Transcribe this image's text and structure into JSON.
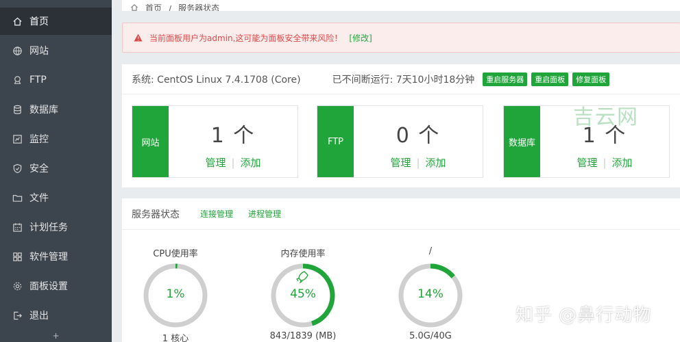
{
  "sidebar": {
    "items": [
      {
        "label": "首页",
        "icon": "home-icon",
        "active": true
      },
      {
        "label": "网站",
        "icon": "globe-icon"
      },
      {
        "label": "FTP",
        "icon": "ftp-icon"
      },
      {
        "label": "数据库",
        "icon": "database-icon"
      },
      {
        "label": "监控",
        "icon": "monitor-icon"
      },
      {
        "label": "安全",
        "icon": "shield-icon"
      },
      {
        "label": "文件",
        "icon": "folder-icon"
      },
      {
        "label": "计划任务",
        "icon": "calendar-icon"
      },
      {
        "label": "软件管理",
        "icon": "grid-icon"
      },
      {
        "label": "面板设置",
        "icon": "gear-icon"
      },
      {
        "label": "退出",
        "icon": "logout-icon"
      }
    ],
    "bottom_glyph": "+"
  },
  "breadcrumb": {
    "home": "首页",
    "sep": "/",
    "current": "服务器状态"
  },
  "alert": {
    "message": "当前面板用户为admin,这可能为面板安全带来风险！",
    "link": "[修改]"
  },
  "system": {
    "os": "系统: CentOS Linux 7.4.1708 (Core)",
    "uptime": "已不间断运行: 7天10小时18分钟",
    "buttons": [
      "重启服务器",
      "重启面板",
      "修复面板"
    ]
  },
  "cards": [
    {
      "tag": "网站",
      "count": "1 个",
      "manage": "管理",
      "add": "添加"
    },
    {
      "tag": "FTP",
      "count": "0 个",
      "manage": "管理",
      "add": "添加"
    },
    {
      "tag": "数据库",
      "count": "1 个",
      "manage": "管理",
      "add": "添加"
    }
  ],
  "watermark": "吉云网",
  "status": {
    "title": "服务器状态",
    "links": [
      "连接管理",
      "进程管理"
    ],
    "gauges": [
      {
        "title": "CPU使用率",
        "value": "1%",
        "percent": 1,
        "sub": "1 核心"
      },
      {
        "title": "内存使用率",
        "value": "45%",
        "percent": 45,
        "sub": "843/1839 (MB)"
      },
      {
        "title": "/",
        "value": "14%",
        "percent": 14,
        "sub": "5.0G/40G"
      }
    ]
  },
  "zhihu_watermark": "知乎 @鼻行动物",
  "colors": {
    "accent": "#20a53a",
    "sidebar": "#3c444d",
    "alert_text": "#e04848"
  }
}
